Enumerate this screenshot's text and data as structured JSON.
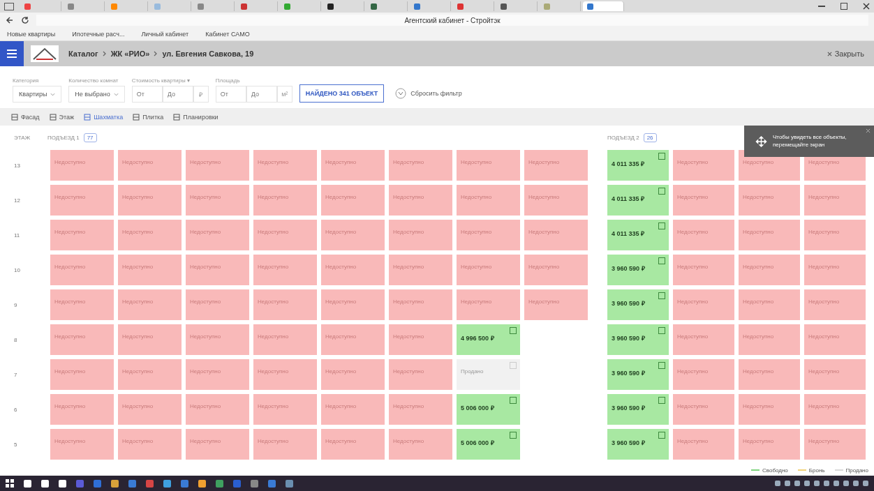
{
  "browser": {
    "title": "Агентский кабинет - Стройтэк",
    "tabs": [
      {
        "selected": false
      },
      {
        "selected": false
      },
      {
        "selected": false
      },
      {
        "selected": false
      },
      {
        "selected": false
      },
      {
        "selected": false
      },
      {
        "selected": false
      },
      {
        "selected": false
      },
      {
        "selected": false
      },
      {
        "selected": false
      },
      {
        "selected": false
      },
      {
        "selected": false
      },
      {
        "selected": false
      },
      {
        "selected": true
      }
    ],
    "bookmarks": [
      "Новые квартиры",
      "Ипотечные расч...",
      "Личный кабинет",
      "Кабинет САМО"
    ]
  },
  "header": {
    "breadcrumbs": [
      "Каталог",
      "ЖК «РИО»",
      "ул. Евгения Савкова, 19"
    ],
    "close": "Закрыть"
  },
  "filters": [
    {
      "kind": "select",
      "label": "Категория",
      "value": "Квартиры"
    },
    {
      "kind": "select",
      "label": "Количество комнат",
      "value": "Не выбрано"
    },
    {
      "kind": "range",
      "label": "Стоимость квартиры ▾",
      "from": {
        "placeholder": "От"
      },
      "to": {
        "placeholder": "До"
      },
      "unit": "₽"
    },
    {
      "kind": "range",
      "label": "Площадь",
      "from": {
        "placeholder": "От"
      },
      "to": {
        "placeholder": "До"
      },
      "unit": "м²"
    }
  ],
  "found_button": "НАЙДЕНО 341 ОБЪЕКТ",
  "reset": "Сбросить фильтр",
  "views": [
    {
      "label": "Фасад",
      "selected": false
    },
    {
      "label": "Этаж",
      "selected": false
    },
    {
      "label": "Шахматка",
      "selected": true
    },
    {
      "label": "Плитка",
      "selected": false
    },
    {
      "label": "Планировки",
      "selected": false
    }
  ],
  "grid": {
    "floor_heading": "ЭТАЖ",
    "entrances": [
      {
        "title": "ПОДЪЕЗД 1",
        "count": "77"
      },
      {
        "title": "ПОДЪЕЗД 2",
        "count": "26"
      }
    ],
    "floors": [
      {
        "floor": "13",
        "e1": [
          {
            "kind": "unavailable",
            "text": "Недоступно"
          },
          {
            "kind": "unavailable",
            "text": "Недоступно"
          },
          {
            "kind": "unavailable",
            "text": "Недоступно"
          },
          {
            "kind": "unavailable",
            "text": "Недоступно"
          },
          {
            "kind": "unavailable",
            "text": "Недоступно"
          },
          {
            "kind": "unavailable",
            "text": "Недоступно"
          },
          {
            "kind": "unavailable",
            "text": "Недоступно"
          },
          {
            "kind": "unavailable",
            "text": "Недоступно"
          }
        ],
        "e2": [
          {
            "kind": "free",
            "price": "4 011 335 ₽"
          },
          {
            "kind": "unavailable",
            "text": "Недоступно"
          },
          {
            "kind": "unavailable",
            "text": "Недоступно"
          },
          {
            "kind": "unavailable",
            "text": "Недоступно"
          }
        ]
      },
      {
        "floor": "12",
        "e1": [
          {
            "kind": "unavailable",
            "text": "Недоступно"
          },
          {
            "kind": "unavailable",
            "text": "Недоступно"
          },
          {
            "kind": "unavailable",
            "text": "Недоступно"
          },
          {
            "kind": "unavailable",
            "text": "Недоступно"
          },
          {
            "kind": "unavailable",
            "text": "Недоступно"
          },
          {
            "kind": "unavailable",
            "text": "Недоступно"
          },
          {
            "kind": "unavailable",
            "text": "Недоступно"
          },
          {
            "kind": "unavailable",
            "text": "Недоступно"
          }
        ],
        "e2": [
          {
            "kind": "free",
            "price": "4 011 335 ₽"
          },
          {
            "kind": "unavailable",
            "text": "Недоступно"
          },
          {
            "kind": "unavailable",
            "text": "Недоступно"
          },
          {
            "kind": "unavailable",
            "text": "Недоступно"
          }
        ]
      },
      {
        "floor": "11",
        "e1": [
          {
            "kind": "unavailable",
            "text": "Недоступно"
          },
          {
            "kind": "unavailable",
            "text": "Недоступно"
          },
          {
            "kind": "unavailable",
            "text": "Недоступно"
          },
          {
            "kind": "unavailable",
            "text": "Недоступно"
          },
          {
            "kind": "unavailable",
            "text": "Недоступно"
          },
          {
            "kind": "unavailable",
            "text": "Недоступно"
          },
          {
            "kind": "unavailable",
            "text": "Недоступно"
          },
          {
            "kind": "unavailable",
            "text": "Недоступно"
          }
        ],
        "e2": [
          {
            "kind": "free",
            "price": "4 011 335 ₽"
          },
          {
            "kind": "unavailable",
            "text": "Недоступно"
          },
          {
            "kind": "unavailable",
            "text": "Недоступно"
          },
          {
            "kind": "unavailable",
            "text": "Недоступно"
          }
        ]
      },
      {
        "floor": "10",
        "e1": [
          {
            "kind": "unavailable",
            "text": "Недоступно"
          },
          {
            "kind": "unavailable",
            "text": "Недоступно"
          },
          {
            "kind": "unavailable",
            "text": "Недоступно"
          },
          {
            "kind": "unavailable",
            "text": "Недоступно"
          },
          {
            "kind": "unavailable",
            "text": "Недоступно"
          },
          {
            "kind": "unavailable",
            "text": "Недоступно"
          },
          {
            "kind": "unavailable",
            "text": "Недоступно"
          },
          {
            "kind": "unavailable",
            "text": "Недоступно"
          }
        ],
        "e2": [
          {
            "kind": "free",
            "price": "3 960 590 ₽"
          },
          {
            "kind": "unavailable",
            "text": "Недоступно"
          },
          {
            "kind": "unavailable",
            "text": "Недоступно"
          },
          {
            "kind": "unavailable",
            "text": "Недоступно"
          }
        ]
      },
      {
        "floor": "9",
        "e1": [
          {
            "kind": "unavailable",
            "text": "Недоступно"
          },
          {
            "kind": "unavailable",
            "text": "Недоступно"
          },
          {
            "kind": "unavailable",
            "text": "Недоступно"
          },
          {
            "kind": "unavailable",
            "text": "Недоступно"
          },
          {
            "kind": "unavailable",
            "text": "Недоступно"
          },
          {
            "kind": "unavailable",
            "text": "Недоступно"
          },
          {
            "kind": "unavailable",
            "text": "Недоступно"
          },
          {
            "kind": "unavailable",
            "text": "Недоступно"
          }
        ],
        "e2": [
          {
            "kind": "free",
            "price": "3 960 590 ₽"
          },
          {
            "kind": "unavailable",
            "text": "Недоступно"
          },
          {
            "kind": "unavailable",
            "text": "Недоступно"
          },
          {
            "kind": "unavailable",
            "text": "Недоступно"
          }
        ]
      },
      {
        "floor": "8",
        "e1": [
          {
            "kind": "unavailable",
            "text": "Недоступно"
          },
          {
            "kind": "unavailable",
            "text": "Недоступно"
          },
          {
            "kind": "unavailable",
            "text": "Недоступно"
          },
          {
            "kind": "unavailable",
            "text": "Недоступно"
          },
          {
            "kind": "unavailable",
            "text": "Недоступно"
          },
          {
            "kind": "unavailable",
            "text": "Недоступно"
          },
          {
            "kind": "free",
            "price": "4 996 500 ₽"
          },
          {
            "kind": "empty"
          }
        ],
        "e2": [
          {
            "kind": "free",
            "price": "3 960 590 ₽"
          },
          {
            "kind": "unavailable",
            "text": "Недоступно"
          },
          {
            "kind": "unavailable",
            "text": "Недоступно"
          },
          {
            "kind": "unavailable",
            "text": "Недоступно"
          }
        ]
      },
      {
        "floor": "7",
        "e1": [
          {
            "kind": "unavailable",
            "text": "Недоступно"
          },
          {
            "kind": "unavailable",
            "text": "Недоступно"
          },
          {
            "kind": "unavailable",
            "text": "Недоступно"
          },
          {
            "kind": "unavailable",
            "text": "Недоступно"
          },
          {
            "kind": "unavailable",
            "text": "Недоступно"
          },
          {
            "kind": "unavailable",
            "text": "Недоступно"
          },
          {
            "kind": "sold",
            "text": "Продано"
          },
          {
            "kind": "empty"
          }
        ],
        "e2": [
          {
            "kind": "free",
            "price": "3 960 590 ₽"
          },
          {
            "kind": "unavailable",
            "text": "Недоступно"
          },
          {
            "kind": "unavailable",
            "text": "Недоступно"
          },
          {
            "kind": "unavailable",
            "text": "Недоступно"
          }
        ]
      },
      {
        "floor": "6",
        "e1": [
          {
            "kind": "unavailable",
            "text": "Недоступно"
          },
          {
            "kind": "unavailable",
            "text": "Недоступно"
          },
          {
            "kind": "unavailable",
            "text": "Недоступно"
          },
          {
            "kind": "unavailable",
            "text": "Недоступно"
          },
          {
            "kind": "unavailable",
            "text": "Недоступно"
          },
          {
            "kind": "unavailable",
            "text": "Недоступно"
          },
          {
            "kind": "free",
            "price": "5 006 000 ₽"
          },
          {
            "kind": "empty"
          }
        ],
        "e2": [
          {
            "kind": "free",
            "price": "3 960 590 ₽"
          },
          {
            "kind": "unavailable",
            "text": "Недоступно"
          },
          {
            "kind": "unavailable",
            "text": "Недоступно"
          },
          {
            "kind": "unavailable",
            "text": "Недоступно"
          }
        ]
      },
      {
        "floor": "5",
        "e1": [
          {
            "kind": "unavailable",
            "text": "Недоступно"
          },
          {
            "kind": "unavailable",
            "text": "Недоступно"
          },
          {
            "kind": "unavailable",
            "text": "Недоступно"
          },
          {
            "kind": "unavailable",
            "text": "Недоступно"
          },
          {
            "kind": "unavailable",
            "text": "Недоступно"
          },
          {
            "kind": "unavailable",
            "text": "Недоступно"
          },
          {
            "kind": "free",
            "price": "5 006 000 ₽"
          },
          {
            "kind": "empty"
          }
        ],
        "e2": [
          {
            "kind": "free",
            "price": "3 960 590 ₽"
          },
          {
            "kind": "unavailable",
            "text": "Недоступно"
          },
          {
            "kind": "unavailable",
            "text": "Недоступно"
          },
          {
            "kind": "unavailable",
            "text": "Недоступно"
          }
        ]
      }
    ]
  },
  "tooltip": "Чтобы увидеть все объекты, перемещайте экран",
  "legend": [
    {
      "label": "Свободно",
      "color": "#7fd47f"
    },
    {
      "label": "Бронь",
      "color": "#f2d27a"
    },
    {
      "label": "Продано",
      "color": "#d9d9d9"
    }
  ]
}
